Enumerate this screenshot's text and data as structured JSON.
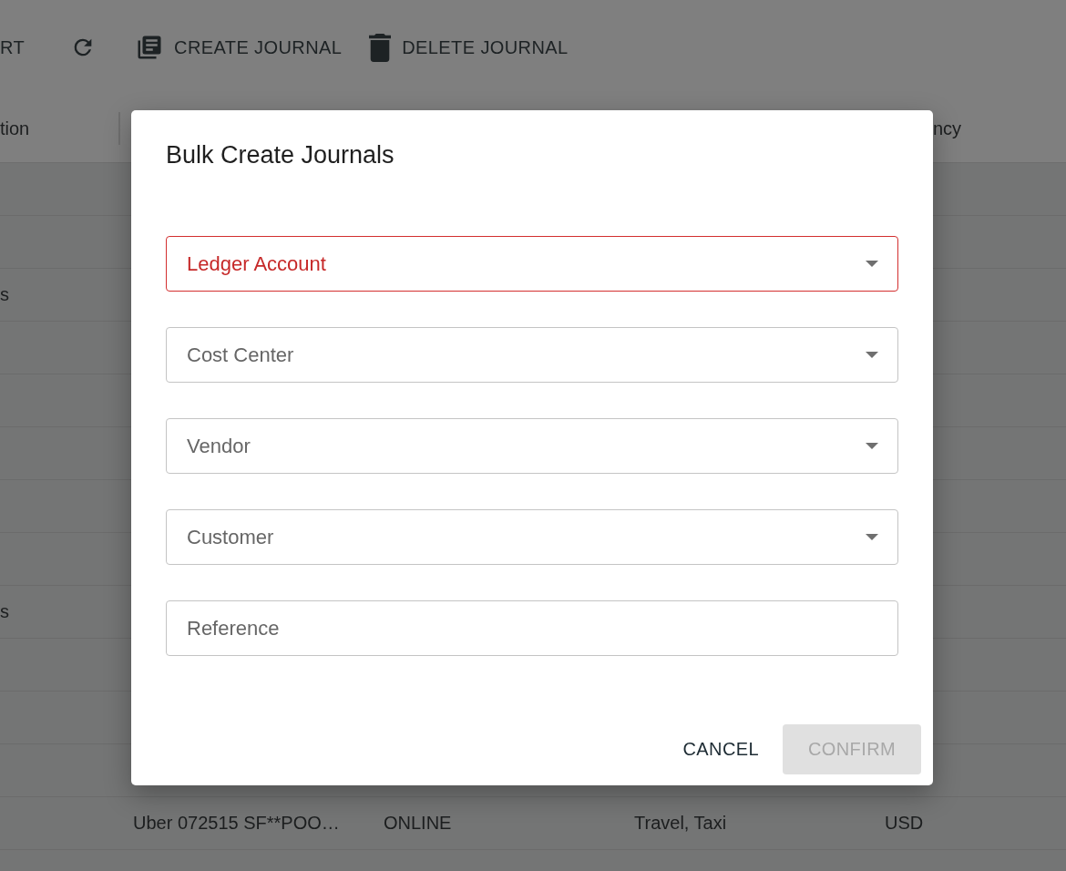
{
  "toolbar": [
    {
      "kind": "text",
      "label": "RT"
    },
    {
      "kind": "refresh"
    },
    {
      "kind": "create",
      "label": "CREATE JOURNAL"
    },
    {
      "kind": "delete",
      "label": "DELETE JOURNAL"
    }
  ],
  "table": {
    "header": {
      "column_1": "tion",
      "column_5": "ncy"
    },
    "rows": [
      {},
      {},
      {
        "column_1": "s"
      },
      {},
      {},
      {},
      {},
      {},
      {
        "column_1": "s"
      },
      {},
      {},
      {},
      {
        "column_2": "Uber 072515 SF**POO…",
        "column_3": "ONLINE",
        "column_4": "Travel, Taxi",
        "column_5": "USD"
      }
    ]
  },
  "dialog": {
    "title": "Bulk Create Journals",
    "fields": [
      {
        "kind": "select",
        "label": "Ledger Account",
        "error": true
      },
      {
        "kind": "select",
        "label": "Cost Center",
        "error": false
      },
      {
        "kind": "select",
        "label": "Vendor",
        "error": false
      },
      {
        "kind": "select",
        "label": "Customer",
        "error": false
      },
      {
        "kind": "text",
        "placeholder": "Reference",
        "error": false
      }
    ],
    "buttons": [
      {
        "label": "CANCEL",
        "disabled": false
      },
      {
        "label": "CONFIRM",
        "disabled": true
      }
    ]
  }
}
